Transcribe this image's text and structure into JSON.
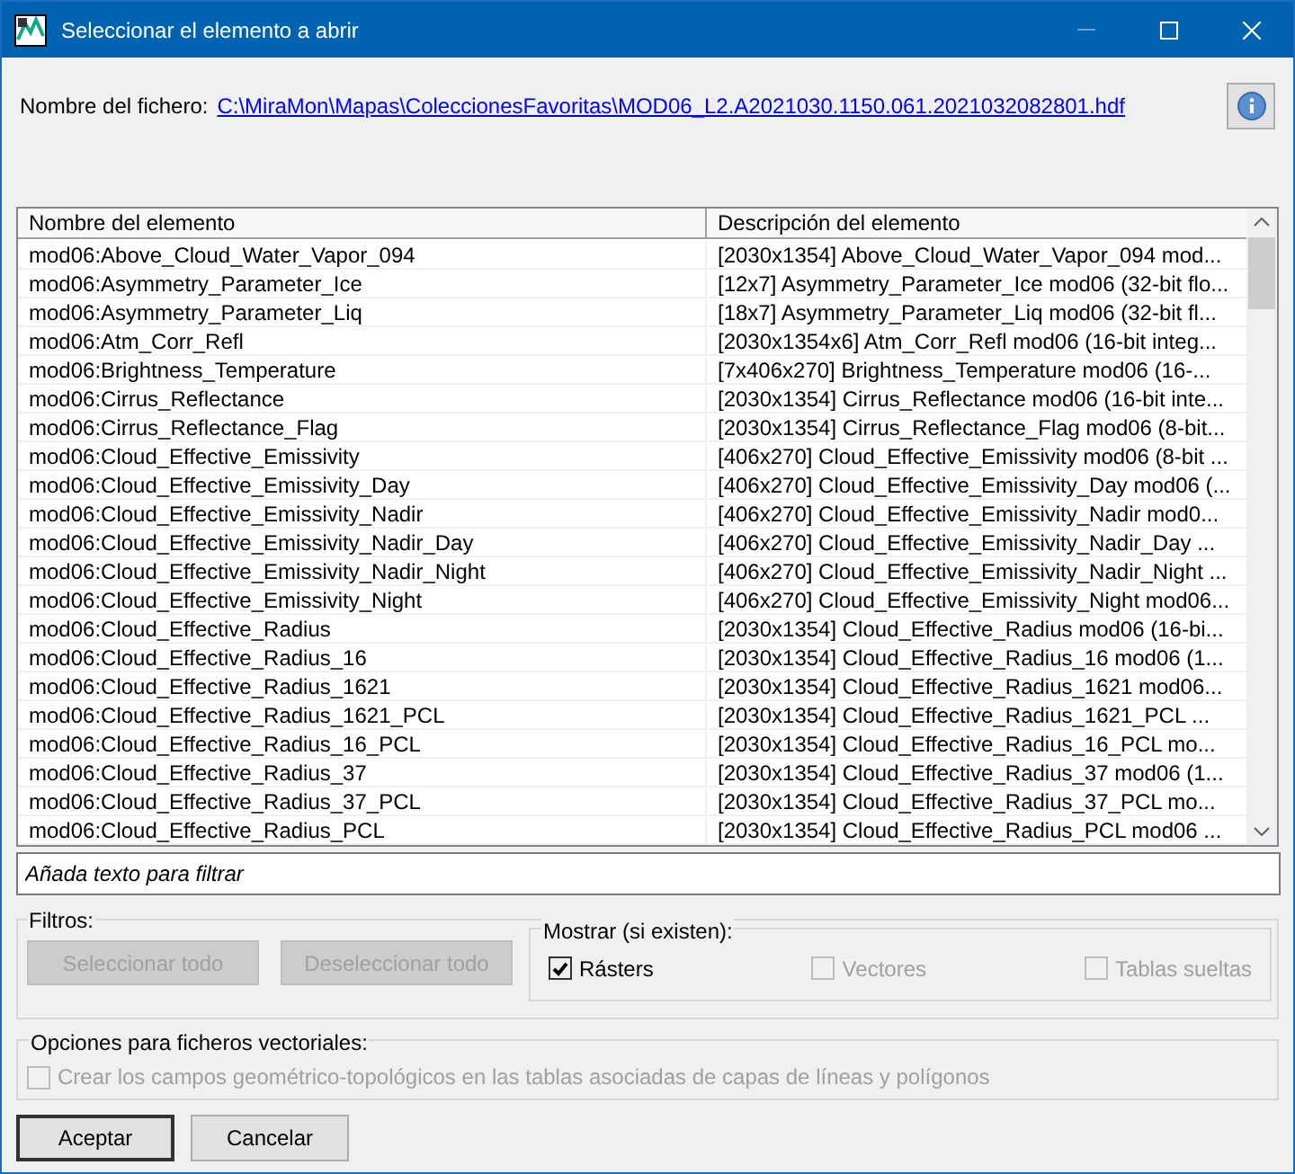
{
  "window": {
    "title": "Seleccionar el elemento a abrir"
  },
  "file": {
    "label": "Nombre del fichero:",
    "path": "C:\\MiraMon\\Mapas\\ColeccionesFavoritas\\MOD06_L2.A2021030.1150.061.2021032082801.hdf"
  },
  "table": {
    "columns": [
      "Nombre del elemento",
      "Descripción del elemento"
    ],
    "rows": [
      [
        "mod06:Above_Cloud_Water_Vapor_094",
        "[2030x1354] Above_Cloud_Water_Vapor_094 mod..."
      ],
      [
        "mod06:Asymmetry_Parameter_Ice",
        "[12x7] Asymmetry_Parameter_Ice mod06 (32-bit flo..."
      ],
      [
        "mod06:Asymmetry_Parameter_Liq",
        "[18x7] Asymmetry_Parameter_Liq mod06 (32-bit fl..."
      ],
      [
        "mod06:Atm_Corr_Refl",
        "[2030x1354x6] Atm_Corr_Refl mod06 (16-bit integ..."
      ],
      [
        "mod06:Brightness_Temperature",
        "[7x406x270] Brightness_Temperature mod06 (16-..."
      ],
      [
        "mod06:Cirrus_Reflectance",
        "[2030x1354] Cirrus_Reflectance mod06 (16-bit inte..."
      ],
      [
        "mod06:Cirrus_Reflectance_Flag",
        "[2030x1354] Cirrus_Reflectance_Flag mod06 (8-bit..."
      ],
      [
        "mod06:Cloud_Effective_Emissivity",
        "[406x270] Cloud_Effective_Emissivity mod06 (8-bit ..."
      ],
      [
        "mod06:Cloud_Effective_Emissivity_Day",
        "[406x270] Cloud_Effective_Emissivity_Day mod06 (..."
      ],
      [
        "mod06:Cloud_Effective_Emissivity_Nadir",
        "[406x270] Cloud_Effective_Emissivity_Nadir mod0..."
      ],
      [
        "mod06:Cloud_Effective_Emissivity_Nadir_Day",
        "[406x270] Cloud_Effective_Emissivity_Nadir_Day ..."
      ],
      [
        "mod06:Cloud_Effective_Emissivity_Nadir_Night",
        "[406x270] Cloud_Effective_Emissivity_Nadir_Night ..."
      ],
      [
        "mod06:Cloud_Effective_Emissivity_Night",
        "[406x270] Cloud_Effective_Emissivity_Night mod06..."
      ],
      [
        "mod06:Cloud_Effective_Radius",
        "[2030x1354] Cloud_Effective_Radius mod06 (16-bi..."
      ],
      [
        "mod06:Cloud_Effective_Radius_16",
        "[2030x1354] Cloud_Effective_Radius_16 mod06 (1..."
      ],
      [
        "mod06:Cloud_Effective_Radius_1621",
        "[2030x1354] Cloud_Effective_Radius_1621 mod06..."
      ],
      [
        "mod06:Cloud_Effective_Radius_1621_PCL",
        "[2030x1354] Cloud_Effective_Radius_1621_PCL ..."
      ],
      [
        "mod06:Cloud_Effective_Radius_16_PCL",
        "[2030x1354] Cloud_Effective_Radius_16_PCL mo..."
      ],
      [
        "mod06:Cloud_Effective_Radius_37",
        "[2030x1354] Cloud_Effective_Radius_37 mod06 (1..."
      ],
      [
        "mod06:Cloud_Effective_Radius_37_PCL",
        "[2030x1354] Cloud_Effective_Radius_37_PCL mo..."
      ],
      [
        "mod06:Cloud_Effective_Radius_PCL",
        "[2030x1354] Cloud_Effective_Radius_PCL mod06 ..."
      ]
    ]
  },
  "filter": {
    "placeholder": "Añada texto para filtrar"
  },
  "filters": {
    "title": "Filtros:",
    "buttons": [
      {
        "label": "Seleccionar todo",
        "disabled": true
      },
      {
        "label": "Deseleccionar todo",
        "disabled": true
      }
    ]
  },
  "show": {
    "title": "Mostrar (si existen):",
    "options": [
      {
        "label": "Rásters",
        "checked": true,
        "disabled": false
      },
      {
        "label": "Vectores",
        "checked": false,
        "disabled": true
      },
      {
        "label": "Tablas sueltas",
        "checked": false,
        "disabled": true
      }
    ]
  },
  "vector_options": {
    "title": "Opciones para ficheros vectoriales:",
    "options": [
      {
        "label": "Crear los campos geométrico-topológicos en las tablas asociadas de capas de líneas y polígonos",
        "checked": false,
        "disabled": true
      }
    ]
  },
  "buttons": [
    {
      "label": "Aceptar",
      "default": true
    },
    {
      "label": "Cancelar",
      "default": false
    }
  ]
}
